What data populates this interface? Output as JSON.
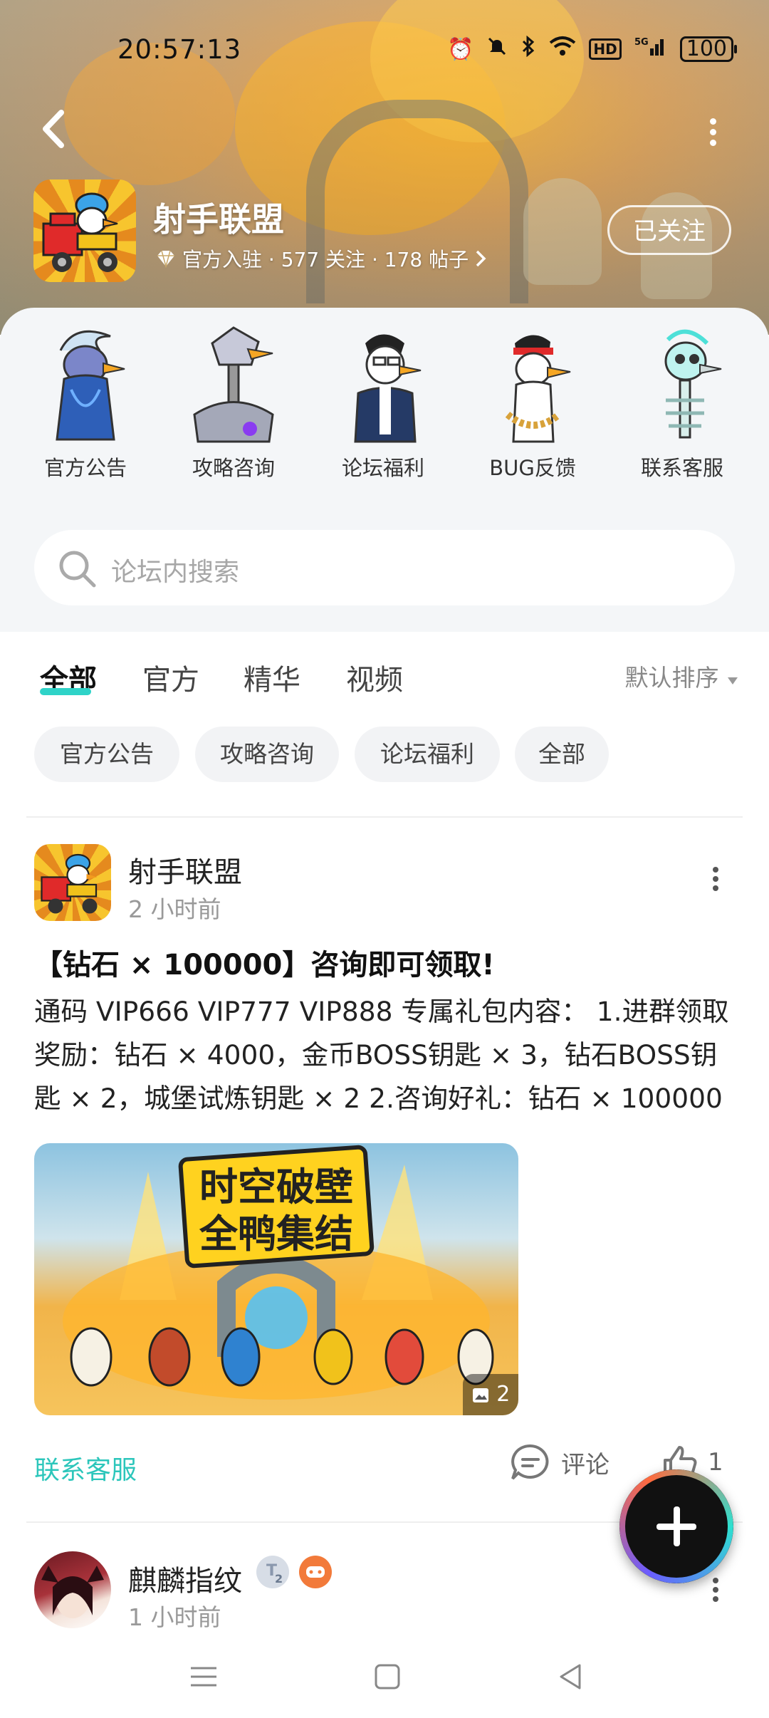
{
  "status_bar": {
    "time": "20:57:13",
    "battery": "100",
    "icons": [
      "alarm-icon",
      "mute-icon",
      "bluetooth-icon",
      "wifi-icon",
      "hd-icon",
      "5g-signal-icon"
    ]
  },
  "header": {
    "forum_name": "射手联盟",
    "meta": "官方入驻 · 577 关注 · 178 帖子",
    "follow_label": "已关注"
  },
  "categories": [
    {
      "label": "官方公告"
    },
    {
      "label": "攻略咨询"
    },
    {
      "label": "论坛福利"
    },
    {
      "label": "BUG反馈"
    },
    {
      "label": "联系客服"
    }
  ],
  "search": {
    "placeholder": "论坛内搜索"
  },
  "tabs": [
    {
      "label": "全部",
      "active": true
    },
    {
      "label": "官方"
    },
    {
      "label": "精华"
    },
    {
      "label": "视频"
    }
  ],
  "sort_label": "默认排序",
  "chips": [
    {
      "label": "官方公告"
    },
    {
      "label": "攻略咨询"
    },
    {
      "label": "论坛福利"
    },
    {
      "label": "全部"
    }
  ],
  "post1": {
    "author": "射手联盟",
    "time": "2 小时前",
    "title": "【钻石 × 100000】咨询即可领取!",
    "body": "通码 VIP666 VIP777 VIP888 专属礼包内容： 1.进群领取奖励：钻石 × 4000，金币BOSS钥匙 × 3，钻石BOSS钥匙 × 2，城堡试炼钥匙 × 2 2.咨询好礼：钻石 × 100000",
    "image_banner_line1": "时空破壁",
    "image_banner_line2": "全鸭集结",
    "image_count": "2",
    "tag_link": "联系客服",
    "comment_label": "评论",
    "like_count": "1"
  },
  "post2": {
    "author": "麒麟指纹",
    "time": "1 小时前",
    "level_badge": "2"
  },
  "colors": {
    "accent": "#2fd3c8",
    "link": "#2cc6bb",
    "chip_bg": "#f2f3f5",
    "sheet_bg": "#f4f6f8"
  }
}
